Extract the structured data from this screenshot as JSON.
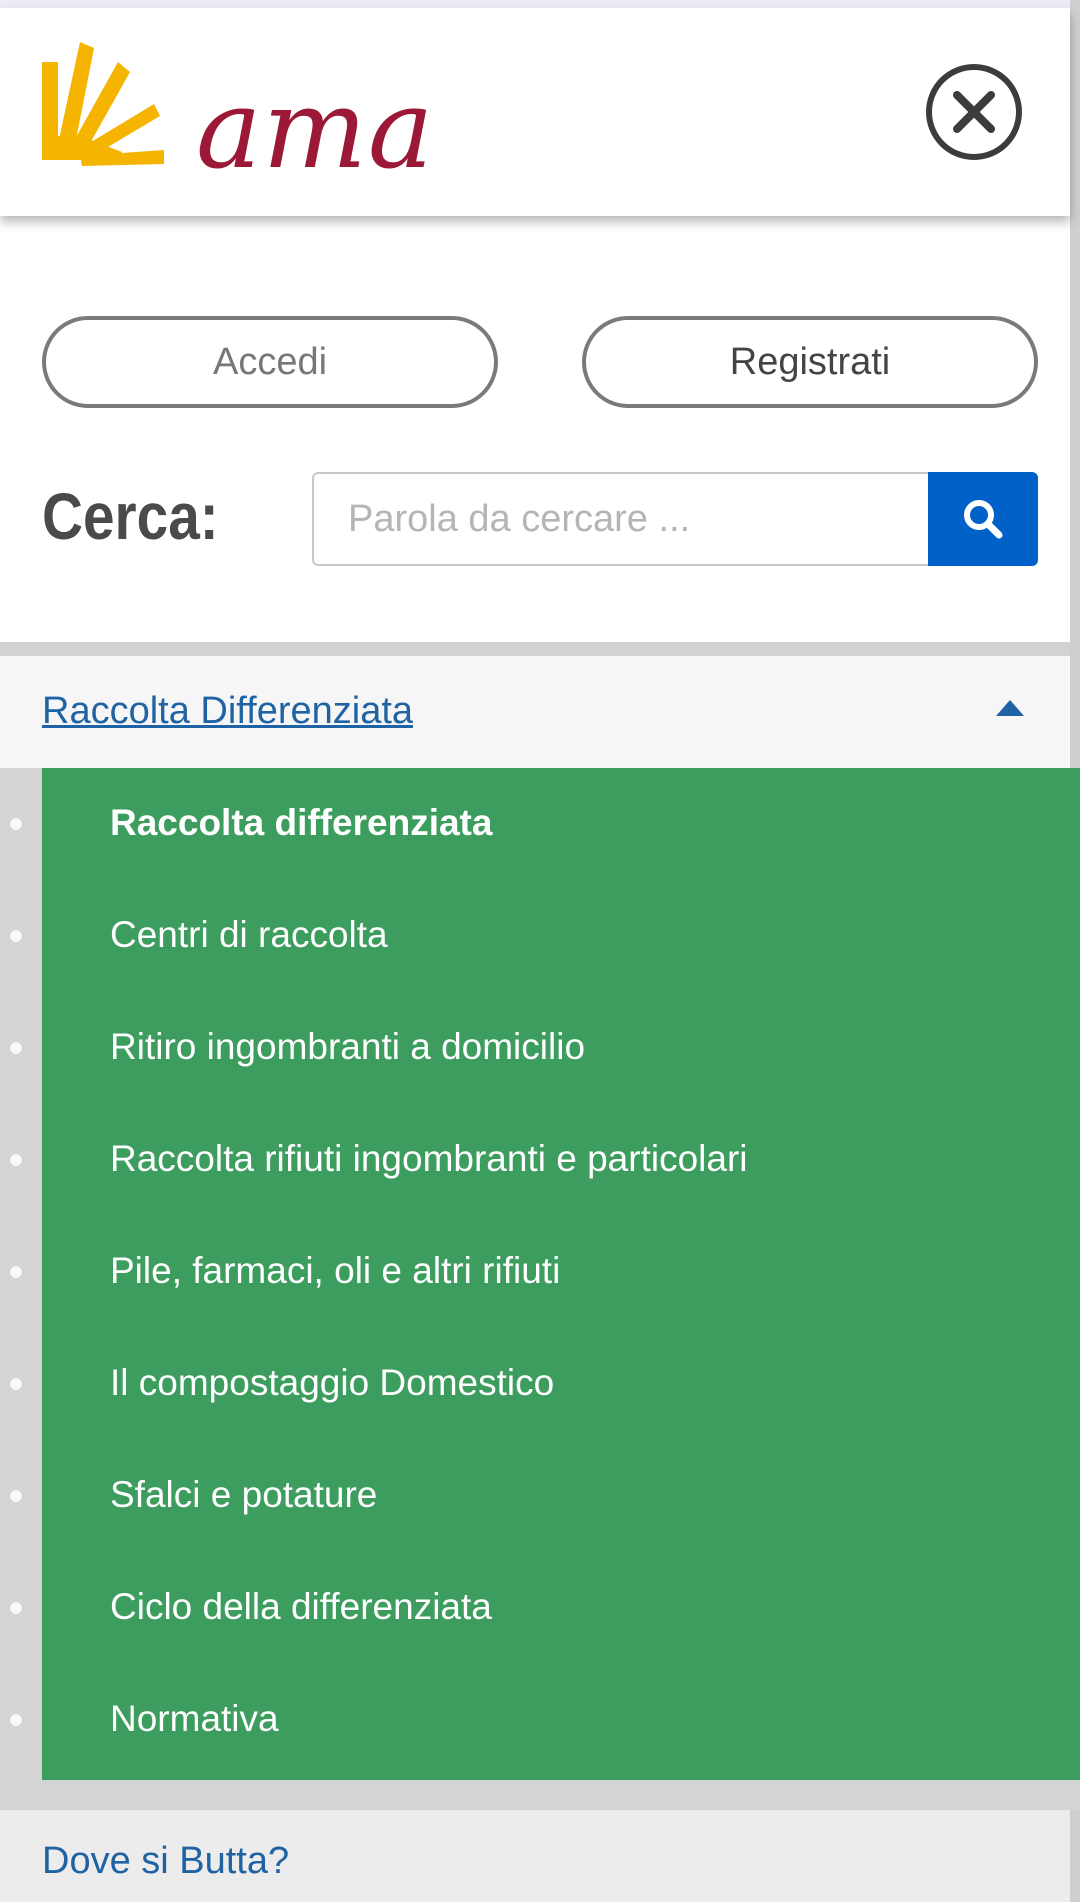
{
  "header": {
    "logo_text": "ama",
    "brand_colors": {
      "mark": "#f5b400",
      "text": "#9b1837"
    }
  },
  "auth": {
    "login_label": "Accedi",
    "register_label": "Registrati"
  },
  "search": {
    "label": "Cerca:",
    "placeholder": "Parola da cercare ...",
    "value": "",
    "button_icon": "search-icon",
    "button_color": "#0062c8"
  },
  "accordion": {
    "title": "Raccolta Differenziata",
    "expanded": true,
    "items": [
      {
        "label": "Raccolta differenziata",
        "active": true
      },
      {
        "label": "Centri di raccolta"
      },
      {
        "label": "Ritiro ingombranti a domicilio"
      },
      {
        "label": "Raccolta rifiuti ingombranti e particolari"
      },
      {
        "label": "Pile, farmaci, oli e altri rifiuti"
      },
      {
        "label": "Il compostaggio Domestico"
      },
      {
        "label": "Sfalci e potature"
      },
      {
        "label": "Ciclo della differenziata"
      },
      {
        "label": "Normativa"
      }
    ],
    "menu_color": "#3d9d5e",
    "link_color": "#1f63a5"
  },
  "next_section": {
    "title": "Dove si Butta?"
  }
}
